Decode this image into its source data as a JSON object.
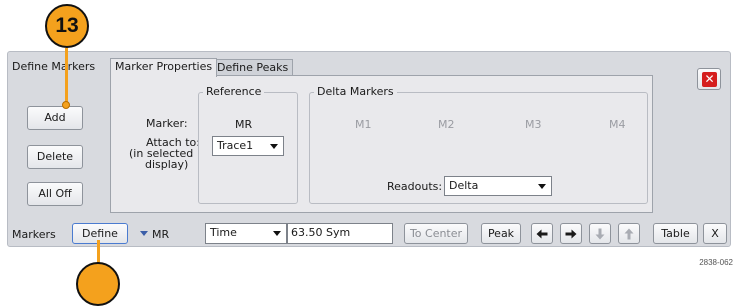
{
  "callout_number": "13",
  "panel_title": "Define Markers",
  "tabs": [
    {
      "label": "Marker Properties",
      "active": true
    },
    {
      "label": "Define Peaks",
      "active": false
    }
  ],
  "side_buttons": {
    "add": "Add",
    "delete": "Delete",
    "all_off": "All Off"
  },
  "reference_group": {
    "title": "Reference",
    "marker_label": "Marker:",
    "marker_value": "MR",
    "attach_label": "Attach to:",
    "attach_note_line1": "(in selected",
    "attach_note_line2": "display)",
    "attach_value": "Trace1"
  },
  "delta_group": {
    "title": "Delta Markers",
    "markers": [
      "M1",
      "M2",
      "M3",
      "M4"
    ],
    "readouts_label": "Readouts:",
    "readouts_value": "Delta"
  },
  "toolbar": {
    "markers_label": "Markers",
    "define_label": "Define",
    "marker_selector": "MR",
    "domain_value": "Time",
    "position_value": "63.50 Sym",
    "to_center_label": "To Center",
    "peak_label": "Peak",
    "table_label": "Table",
    "x_label": "X"
  },
  "figure_caption": "2838-062",
  "colors": {
    "callout": "#f4a11d",
    "close": "#d51e1e",
    "arrow_active": "#1a1a1a",
    "arrow_disabled": "#a9acb3"
  }
}
